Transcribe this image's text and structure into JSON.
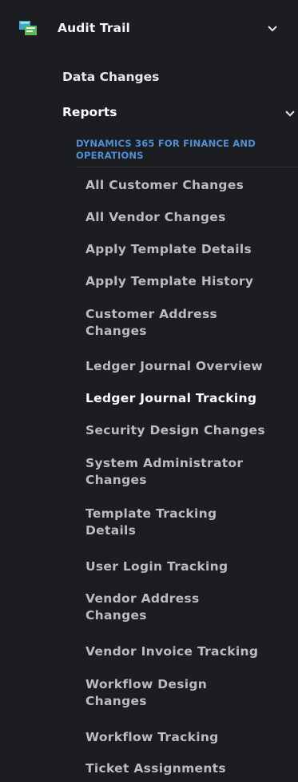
{
  "section": {
    "title": "Audit Trail",
    "icon": "audit-trail-icon"
  },
  "items": {
    "data_changes": "Data Changes",
    "reports": "Reports"
  },
  "category": "DYNAMICS 365 FOR FINANCE AND OPERATIONS",
  "reports": [
    "All Customer Changes",
    "All Vendor Changes",
    "Apply Template Details",
    "Apply Template History",
    "Customer Address Changes",
    "Ledger Journal Overview",
    "Ledger Journal Tracking",
    "Security Design Changes",
    "System Administrator Changes",
    "Template Tracking Details",
    "User Login Tracking",
    "Vendor Address Changes",
    "Vendor Invoice Tracking",
    "Workflow Design Changes",
    "Workflow Tracking",
    "Ticket Assignments"
  ],
  "colors": {
    "background": "#1b1d20",
    "category_accent": "#4e8fd6",
    "active_text": "#ffffff"
  }
}
